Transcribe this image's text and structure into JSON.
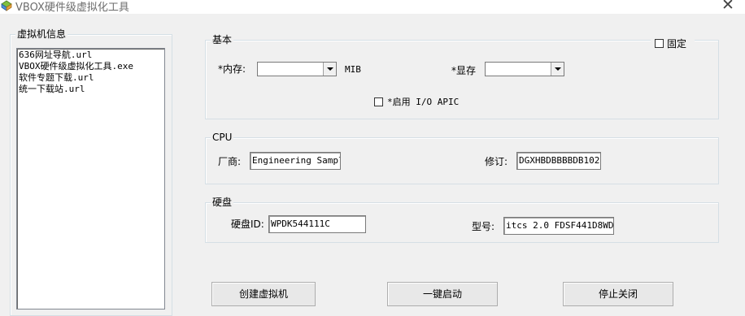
{
  "window": {
    "title": "VBOX硬件级虚拟化工具",
    "close_label": "✕"
  },
  "left": {
    "group_title": "虚拟机信息",
    "files": [
      "636网址导航.url",
      "VBOX硬件级虚拟化工具.exe",
      "软件专题下载.url",
      "统一下载站.url"
    ]
  },
  "basic": {
    "group_title": "基本",
    "memory_label": "*内存:",
    "memory_value": "",
    "memory_unit": "MIB",
    "vram_label": "*显存",
    "vram_value": "",
    "io_apic_label": "*启用 I/O APIC",
    "fixed_label": "固定"
  },
  "cpu": {
    "group_title": "CPU",
    "vendor_label": "厂商:",
    "vendor_value": "Engineering Sample",
    "revision_label": "修订:",
    "revision_value": "DGXHBDBBBBDB102"
  },
  "disk": {
    "group_title": "硬盘",
    "id_label": "硬盘ID:",
    "id_value": "WPDK544111C",
    "model_label": "型号:",
    "model_value": "itcs  2.0 FDSF441D8WD"
  },
  "buttons": [
    "创建虚拟机",
    "一键启动",
    "停止关闭"
  ]
}
